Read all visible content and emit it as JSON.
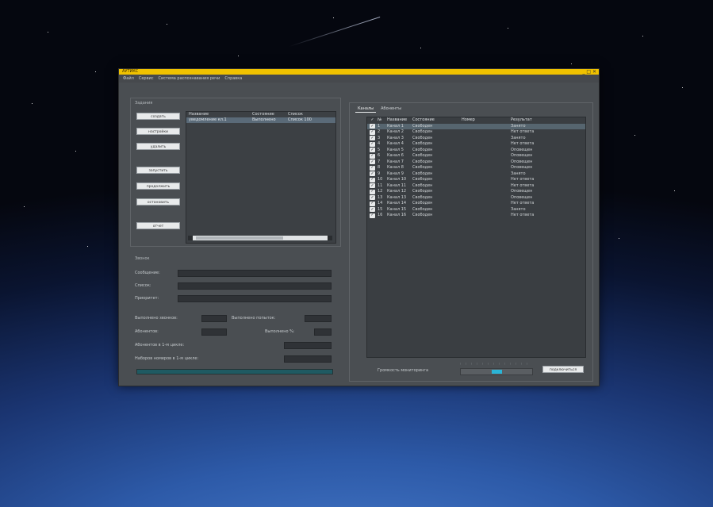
{
  "window": {
    "title": "АУТИКС",
    "controls": "_ □ ✕"
  },
  "menu": [
    "Файл",
    "Сервис",
    "Система распознавания речи",
    "Справка"
  ],
  "left": {
    "tasks_label": "Задания",
    "buttons": [
      "создать",
      "настройки",
      "удалить",
      "запустить",
      "продолжить",
      "остановить",
      "отчет"
    ],
    "task_list": {
      "headers": [
        "Название",
        "Состояние",
        "Список"
      ],
      "rows": [
        [
          "уведомление кл.1",
          "Выполнено",
          "Список 100"
        ]
      ]
    },
    "calls_label": "Звонок",
    "fields": {
      "message": "Сообщение:",
      "list": "Список:",
      "priority": "Приоритет:"
    },
    "stats": {
      "done_calls": "Выполнено звонков:",
      "done_attempts": "Выполнено попыток:",
      "subscribers": "Абонентов:",
      "done_pct": "Выполнено %:",
      "subs_cycle": "Абонентов в 1-м цикле:",
      "dial_cycle": "Наборов номеров в 1-м цикле:"
    },
    "progress": 1.0
  },
  "right": {
    "tabs": [
      "Каналы",
      "Абоненты"
    ],
    "grid": {
      "headers": [
        "",
        "№",
        "Название",
        "Состояние",
        "Номер",
        "Результат"
      ],
      "rows": [
        [
          "1",
          "Канал 1",
          "Свободен",
          "",
          "Занято"
        ],
        [
          "2",
          "Канал 2",
          "Свободен",
          "",
          "Нет ответа"
        ],
        [
          "3",
          "Канал 3",
          "Свободен",
          "",
          "Занято"
        ],
        [
          "4",
          "Канал 4",
          "Свободен",
          "",
          "Нет ответа"
        ],
        [
          "5",
          "Канал 5",
          "Свободен",
          "",
          "Оповещен"
        ],
        [
          "6",
          "Канал 6",
          "Свободен",
          "",
          "Оповещен"
        ],
        [
          "7",
          "Канал 7",
          "Свободен",
          "",
          "Оповещен"
        ],
        [
          "8",
          "Канал 8",
          "Свободен",
          "",
          "Оповещен"
        ],
        [
          "9",
          "Канал 9",
          "Свободен",
          "",
          "Занято"
        ],
        [
          "10",
          "Канал 10",
          "Свободен",
          "",
          "Нет ответа"
        ],
        [
          "11",
          "Канал 11",
          "Свободен",
          "",
          "Нет ответа"
        ],
        [
          "12",
          "Канал 12",
          "Свободен",
          "",
          "Оповещен"
        ],
        [
          "13",
          "Канал 13",
          "Свободен",
          "",
          "Оповещен"
        ],
        [
          "14",
          "Канал 14",
          "Свободен",
          "",
          "Нет ответа"
        ],
        [
          "15",
          "Канал 15",
          "Свободен",
          "",
          "Занято"
        ],
        [
          "16",
          "Канал 16",
          "Свободен",
          "",
          "Нет ответа"
        ]
      ]
    },
    "volume_label": "Громкость мониторинга",
    "slider_value": 0.5,
    "listen_button": "подключиться"
  },
  "colors": {
    "titlebar": "#f0c200",
    "window_bg": "#4a4e52",
    "accent": "#2ab4d6"
  }
}
